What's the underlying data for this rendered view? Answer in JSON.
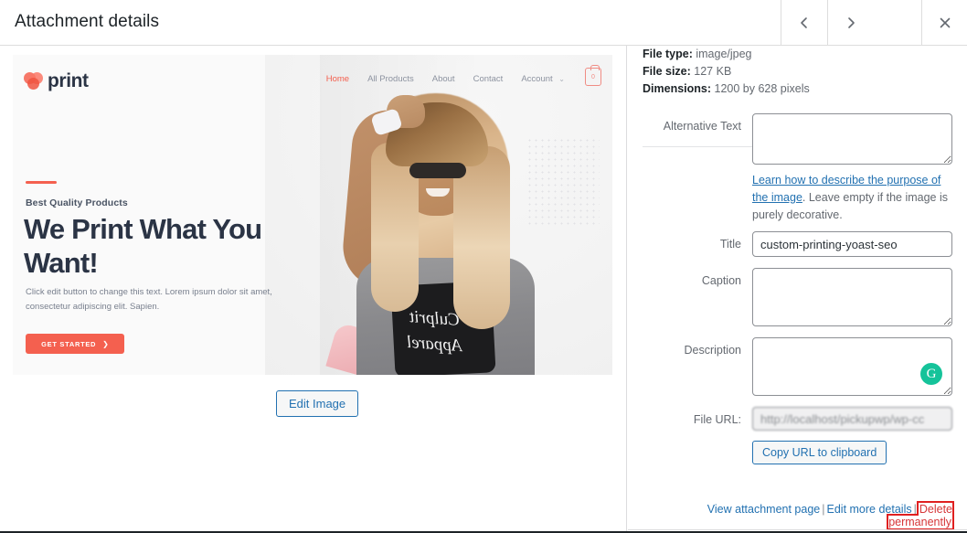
{
  "header": {
    "title": "Attachment details",
    "prev_label": "Previous media item",
    "next_label": "Next media item",
    "close_label": "Close dialog"
  },
  "preview": {
    "site": {
      "brand": "print",
      "nav": [
        {
          "label": "Home",
          "active": true,
          "caret": ""
        },
        {
          "label": "All Products",
          "active": false,
          "caret": ""
        },
        {
          "label": "About",
          "active": false,
          "caret": ""
        },
        {
          "label": "Contact",
          "active": false,
          "caret": ""
        },
        {
          "label": "Account",
          "active": false,
          "caret": "⌄"
        }
      ],
      "cart_count": "0",
      "hero_kicker": "Best Quality Products",
      "hero_title": "We Print What You Want!",
      "hero_sub": "Click edit button to change this text. Lorem ipsum dolor sit amet, consectetur adipiscing elit. Sapien.",
      "cta_label": "GET STARTED",
      "cta_arrow": "❯",
      "shirt_script_1": "Culprit",
      "shirt_script_2": "Apparel"
    },
    "edit_image_label": "Edit Image"
  },
  "details": {
    "file_type_label": "File type:",
    "file_type_value": "image/jpeg",
    "file_size_label": "File size:",
    "file_size_value": "127 KB",
    "dimensions_label": "Dimensions:",
    "dimensions_value": "1200 by 628 pixels",
    "alt_label": "Alternative Text",
    "alt_value": "",
    "alt_help_link": "Learn how to describe the purpose of the image",
    "alt_help_rest": ". Leave empty if the image is purely decorative.",
    "title_label": "Title",
    "title_value": "custom-printing-yoast-seo",
    "caption_label": "Caption",
    "caption_value": "",
    "description_label": "Description",
    "description_value": "",
    "grammarly_icon": "G",
    "file_url_label": "File URL:",
    "file_url_value": "http://localhost/pickupwp/wp-cc",
    "copy_url_label": "Copy URL to clipboard"
  },
  "actions": {
    "view_attachment": "View attachment page",
    "edit_more": "Edit more details",
    "delete": "Delete permanently",
    "separator": "|"
  },
  "colors": {
    "accent_blue": "#2271b1",
    "danger_red": "#d63638",
    "highlight_red": "#e02020",
    "brand_coral": "#f4604f",
    "grammarly_green": "#15c39a"
  }
}
